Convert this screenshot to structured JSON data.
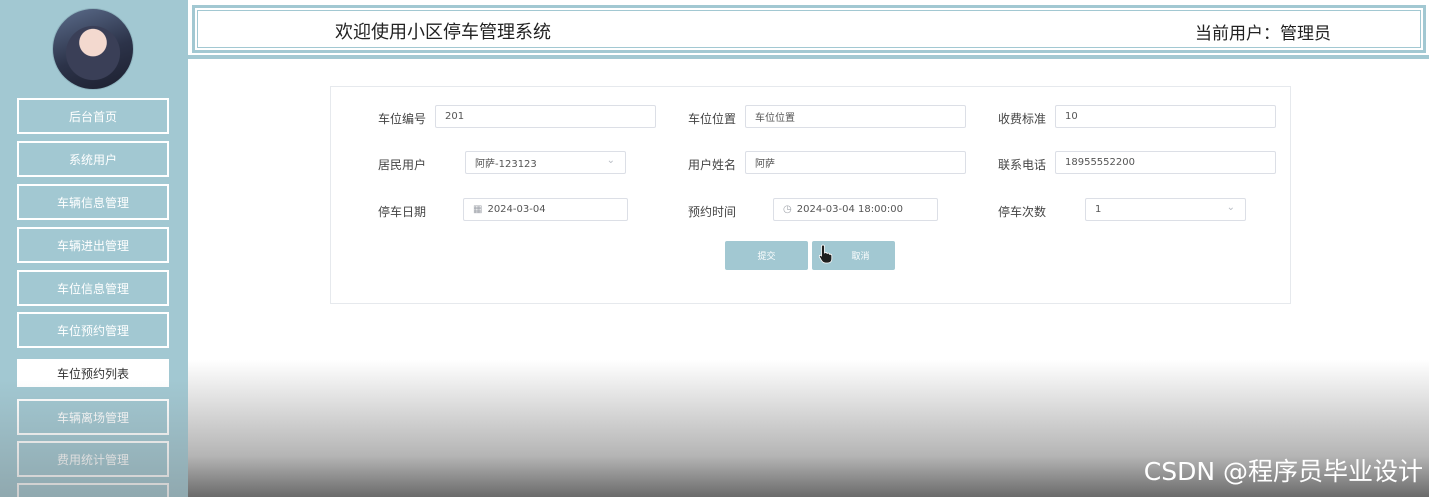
{
  "header": {
    "title": "欢迎使用小区停车管理系统",
    "current_user": "当前用户：管理员"
  },
  "sidebar": {
    "avatar_alt": "",
    "items": [
      {
        "label": "后台首页"
      },
      {
        "label": "系统用户"
      },
      {
        "label": "车辆信息管理"
      },
      {
        "label": "车辆进出管理"
      },
      {
        "label": "车位信息管理"
      },
      {
        "label": "车位预约管理"
      },
      {
        "label": "车位预约列表"
      },
      {
        "label": "车辆离场管理"
      },
      {
        "label": "费用统计管理"
      }
    ],
    "active_index": 6
  },
  "form": {
    "spot_no": {
      "label": "车位编号",
      "value": "201"
    },
    "spot_location": {
      "label": "车位位置",
      "value": "车位位置"
    },
    "fee_standard": {
      "label": "收费标准",
      "value": "10"
    },
    "resident_user": {
      "label": "居民用户",
      "value": "阿萨-123123"
    },
    "user_name": {
      "label": "用户姓名",
      "value": "阿萨"
    },
    "phone": {
      "label": "联系电话",
      "value": "18955552200"
    },
    "park_date": {
      "label": "停车日期",
      "value": "2024-03-04"
    },
    "reserve_time": {
      "label": "预约时间",
      "value": "2024-03-04 18:00:00"
    },
    "park_count": {
      "label": "停车次数",
      "value": "1"
    },
    "submit_label": "提交",
    "cancel_label": "取消"
  },
  "icons": {
    "calendar": "calendar-icon",
    "clock": "clock-icon",
    "chevron": "chevron-down-icon",
    "cursor": "hand-pointer-icon"
  },
  "colors": {
    "accent": "#a2c8d2",
    "border": "#dcdfe6"
  },
  "watermark": "CSDN @程序员毕业设计"
}
